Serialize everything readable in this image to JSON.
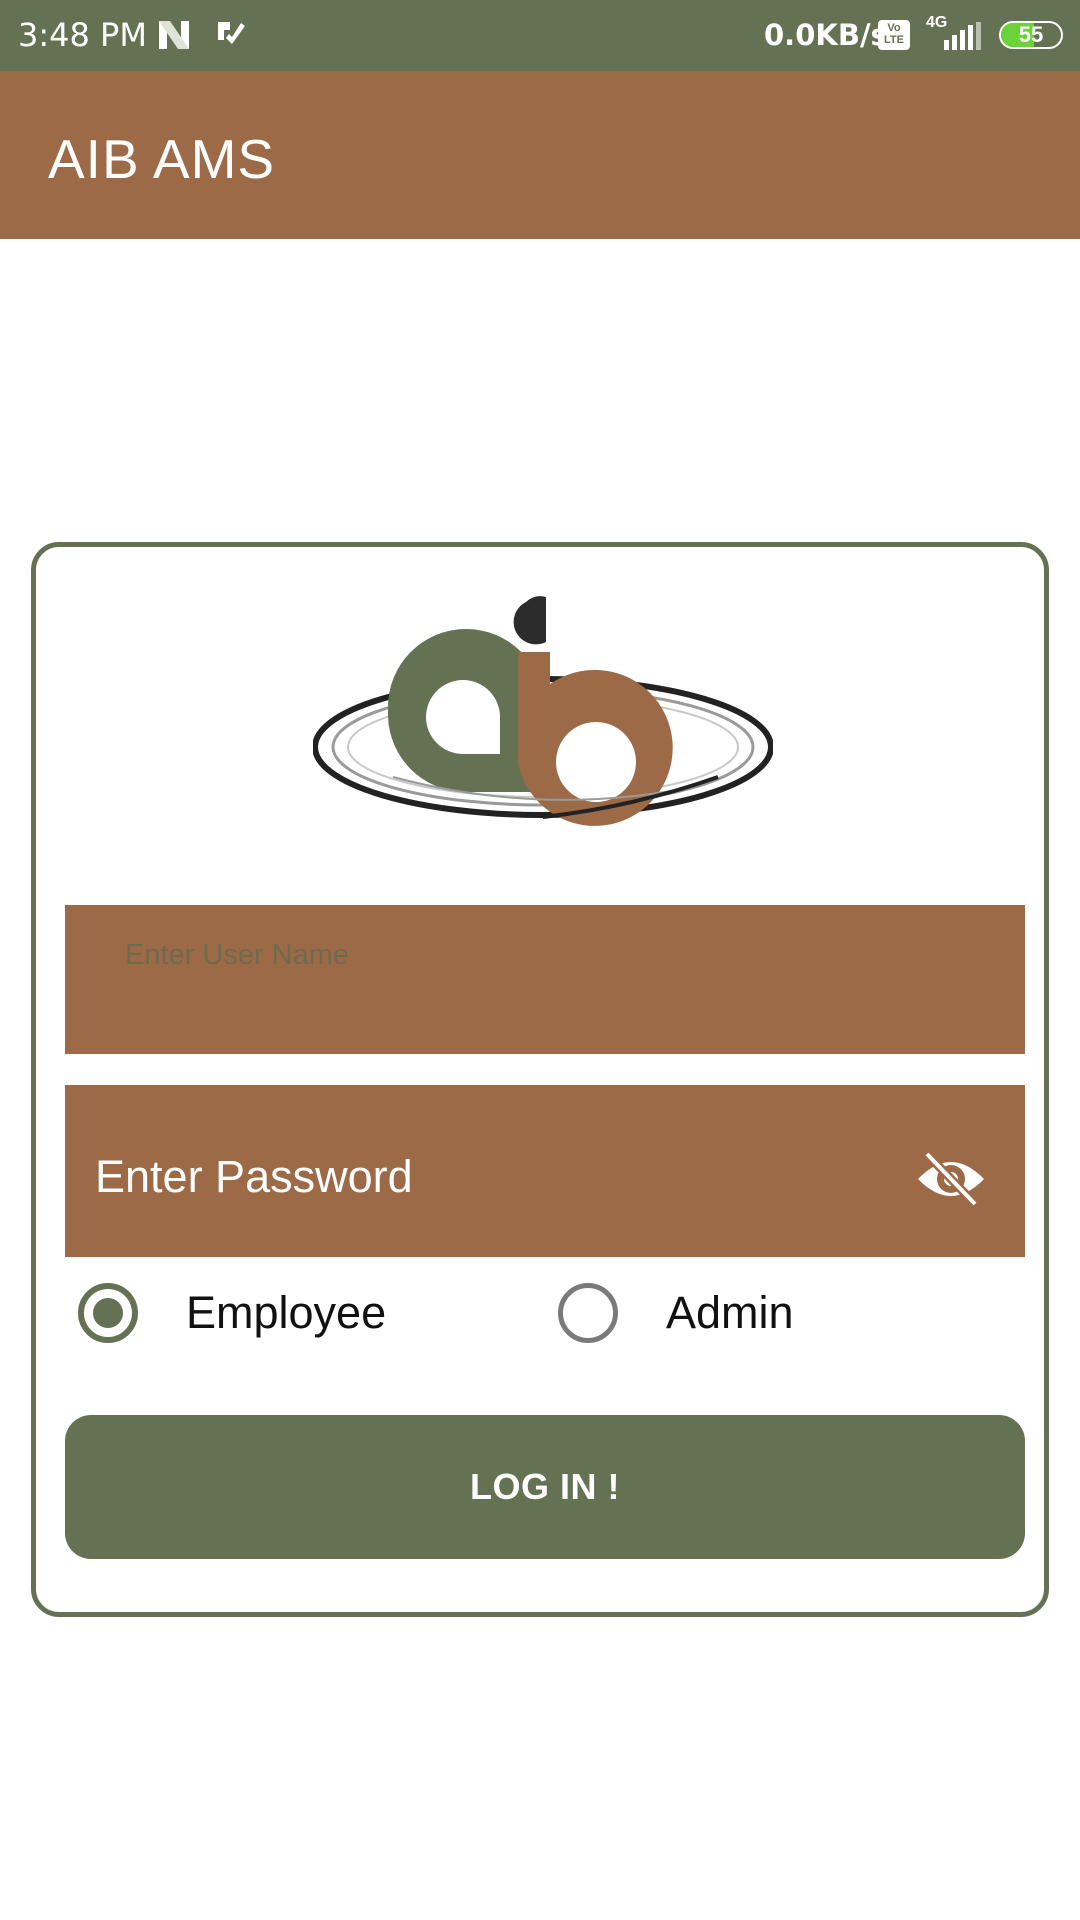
{
  "status_bar": {
    "time": "3:48 PM",
    "net_speed": "0.0KB/s",
    "volte": "Vo LTE",
    "network_type": "4G",
    "battery_level": "55",
    "battery_fraction": 0.55,
    "icons": [
      "n-notification-icon",
      "check-notification-icon",
      "volte-icon",
      "signal-icon",
      "battery-icon"
    ]
  },
  "app_bar": {
    "title": "AIB AMS",
    "color": "#9c6a47"
  },
  "login": {
    "logo_letters": "aib",
    "username_placeholder": "Enter User Name",
    "username_value": "",
    "password_label": "Enter Password",
    "password_toggle_icon": "eye-off-icon",
    "roles": [
      {
        "label": "Employee",
        "selected": true
      },
      {
        "label": "Admin",
        "selected": false
      }
    ],
    "submit_label": "LOG IN !"
  },
  "colors": {
    "primary_green": "#647152",
    "accent_brown": "#9c6a47"
  }
}
